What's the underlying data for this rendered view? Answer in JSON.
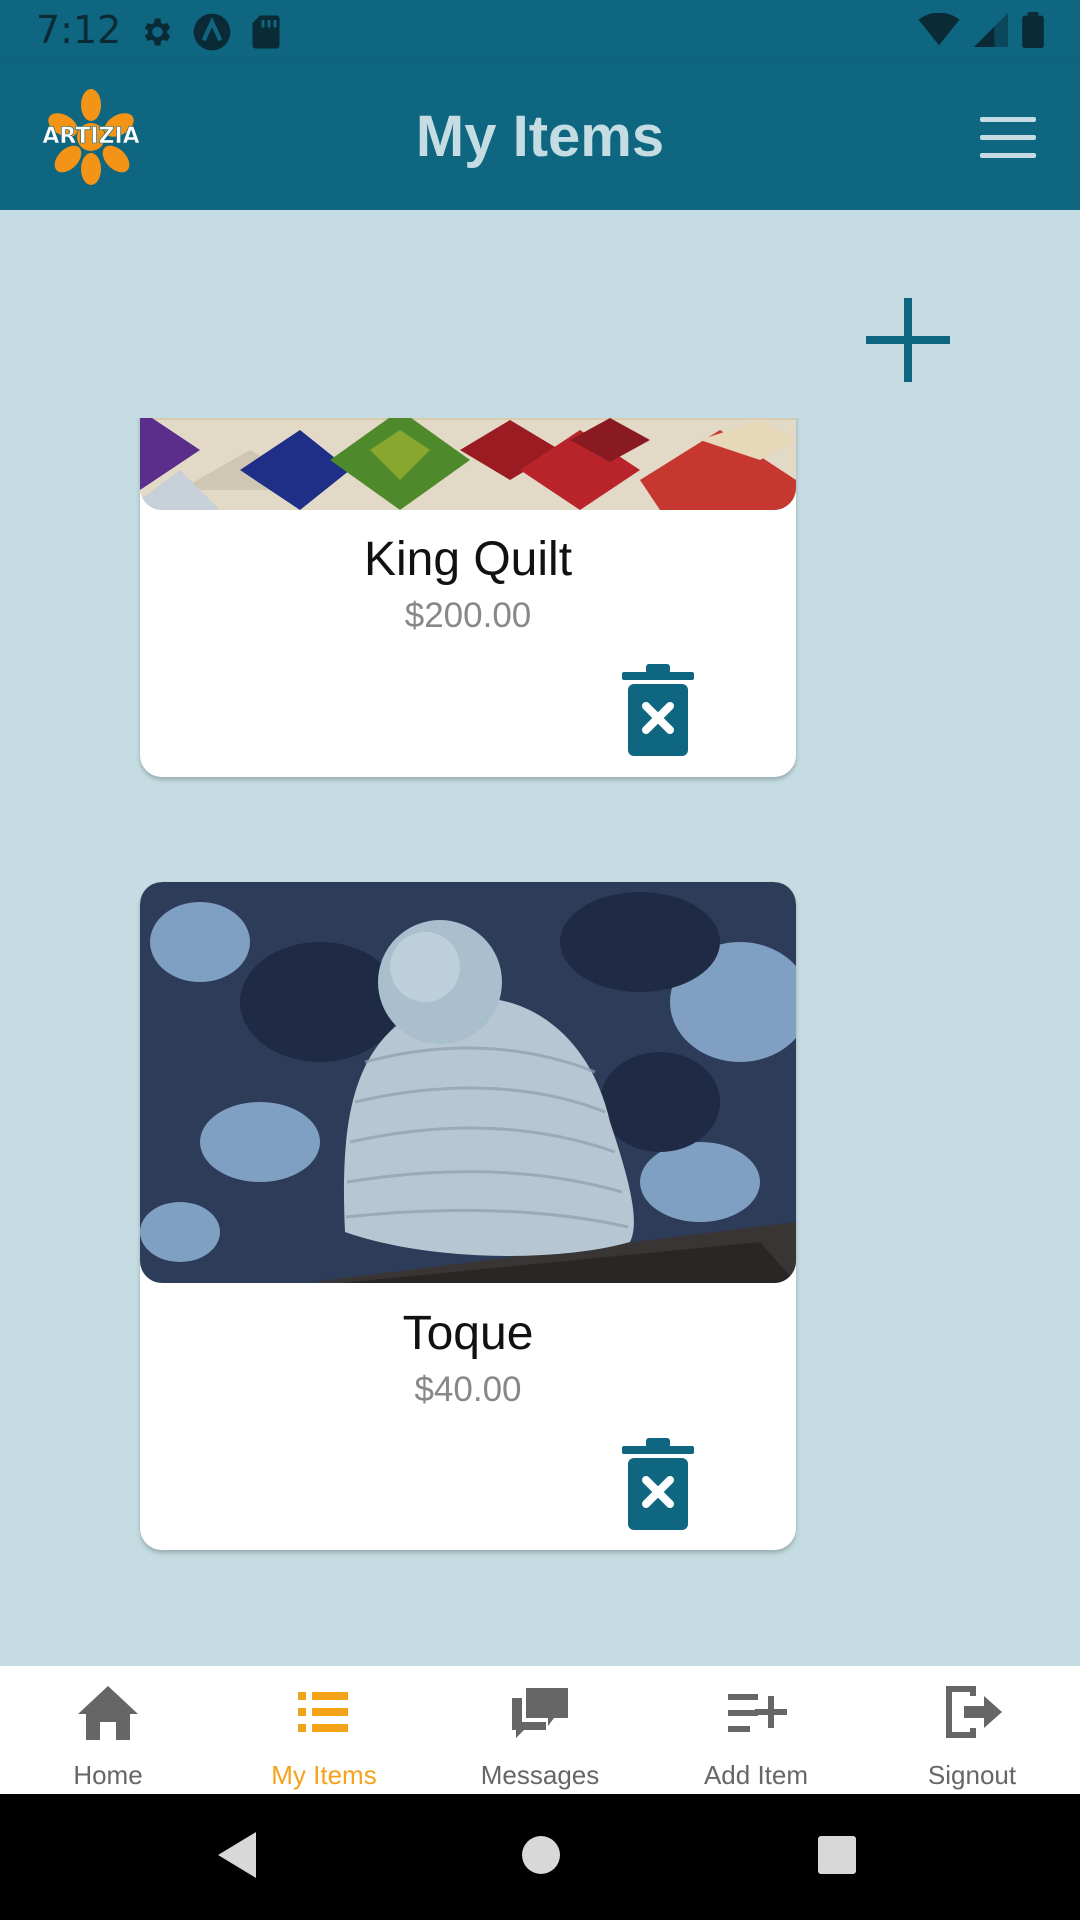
{
  "status_bar": {
    "time": "7:12"
  },
  "app_bar": {
    "title": "My Items",
    "logo_text": "ARTIZIA"
  },
  "items": [
    {
      "title": "King Quilt",
      "price": "$200.00"
    },
    {
      "title": "Toque",
      "price": "$40.00"
    }
  ],
  "bottom_nav": {
    "items": [
      {
        "label": "Home",
        "icon": "home-icon",
        "active": false
      },
      {
        "label": "My Items",
        "icon": "list-icon",
        "active": true
      },
      {
        "label": "Messages",
        "icon": "chat-icon",
        "active": false
      },
      {
        "label": "Add Item",
        "icon": "playlist-add-icon",
        "active": false
      },
      {
        "label": "Signout",
        "icon": "signout-icon",
        "active": false
      }
    ]
  },
  "colors": {
    "primary": "#0e6680",
    "background": "#c5dde2",
    "accent": "#f5a21b",
    "inactive": "#666666"
  }
}
